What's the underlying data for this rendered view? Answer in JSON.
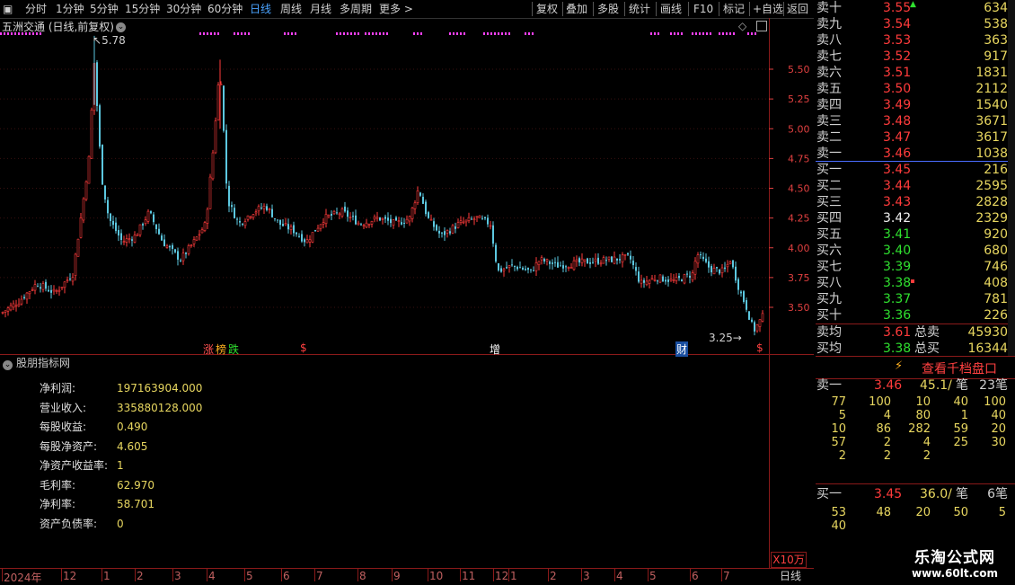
{
  "toolbar": {
    "left_items": [
      "分时",
      "1分钟",
      "5分钟",
      "15分钟",
      "30分钟",
      "60分钟",
      "日线",
      "周线",
      "月线",
      "多周期",
      "更多 >"
    ],
    "active": "日线",
    "right_items": [
      "复权",
      "叠加",
      "多股",
      "统计",
      "画线",
      "F10",
      "标记",
      "+自选",
      "返回"
    ]
  },
  "chart": {
    "title": "五洲交通 (日线,前复权)",
    "y_ticks": [
      "5.50",
      "5.25",
      "5.00",
      "4.75",
      "4.50",
      "4.25",
      "4.00",
      "3.75",
      "3.50"
    ],
    "high_label": "5.78",
    "low_label": "3.25",
    "markers": [
      "涨",
      "榜",
      "跌",
      "$",
      "增",
      "财",
      "$"
    ],
    "scale_label": "X10万",
    "period_label": "日线",
    "x_ticks": [
      "2024年",
      "12",
      "1",
      "2",
      "3",
      "4",
      "5",
      "6",
      "7",
      "8",
      "9",
      "10",
      "11",
      "12",
      "1",
      "2",
      "3",
      "4",
      "5",
      "6",
      "7"
    ]
  },
  "indicator": {
    "header": "股朋指标网",
    "rows": [
      {
        "label": "净利润:",
        "value": "197163904.000"
      },
      {
        "label": "营业收入:",
        "value": "335880128.000"
      },
      {
        "label": "每股收益:",
        "value": "0.490"
      },
      {
        "label": "每股净资产:",
        "value": "4.605"
      },
      {
        "label": "净资产收益率:",
        "value": "1"
      },
      {
        "label": "毛利率:",
        "value": "62.970"
      },
      {
        "label": "净利率:",
        "value": "58.701"
      },
      {
        "label": "资产负债率:",
        "value": "0"
      }
    ]
  },
  "book": {
    "sells": [
      {
        "name": "卖十",
        "price": "3.55",
        "vol": "634"
      },
      {
        "name": "卖九",
        "price": "3.54",
        "vol": "538"
      },
      {
        "name": "卖八",
        "price": "3.53",
        "vol": "363"
      },
      {
        "name": "卖七",
        "price": "3.52",
        "vol": "917"
      },
      {
        "name": "卖六",
        "price": "3.51",
        "vol": "1831"
      },
      {
        "name": "卖五",
        "price": "3.50",
        "vol": "2112"
      },
      {
        "name": "卖四",
        "price": "3.49",
        "vol": "1540"
      },
      {
        "name": "卖三",
        "price": "3.48",
        "vol": "3671"
      },
      {
        "name": "卖二",
        "price": "3.47",
        "vol": "3617"
      },
      {
        "name": "卖一",
        "price": "3.46",
        "vol": "1038"
      }
    ],
    "buys": [
      {
        "name": "买一",
        "price": "3.45",
        "vol": "216"
      },
      {
        "name": "买二",
        "price": "3.44",
        "vol": "2595"
      },
      {
        "name": "买三",
        "price": "3.43",
        "vol": "2828"
      },
      {
        "name": "买四",
        "price": "3.42",
        "vol": "2329"
      },
      {
        "name": "买五",
        "price": "3.41",
        "vol": "920"
      },
      {
        "name": "买六",
        "price": "3.40",
        "vol": "680"
      },
      {
        "name": "买七",
        "price": "3.39",
        "vol": "746"
      },
      {
        "name": "买八",
        "price": "3.38",
        "vol": "408"
      },
      {
        "name": "买九",
        "price": "3.37",
        "vol": "781"
      },
      {
        "name": "买十",
        "price": "3.36",
        "vol": "226"
      }
    ],
    "avg_sell": {
      "label": "卖均",
      "price": "3.61",
      "total_label": "总卖",
      "total": "45930"
    },
    "avg_buy": {
      "label": "买均",
      "price": "3.38",
      "total_label": "总买",
      "total": "16344"
    }
  },
  "depth": {
    "button": "查看千档盘口",
    "sell1": {
      "label": "卖一",
      "price": "3.46",
      "per": "45.1/",
      "unit": "笔",
      "count": "23笔"
    },
    "sell_grid": [
      [
        "77",
        "100",
        "10",
        "40",
        "100"
      ],
      [
        "5",
        "4",
        "80",
        "1",
        "40"
      ],
      [
        "10",
        "86",
        "282",
        "59",
        "20"
      ],
      [
        "57",
        "2",
        "4",
        "25",
        "30"
      ],
      [
        "2",
        "2",
        "2",
        "",
        ""
      ]
    ],
    "buy1": {
      "label": "买一",
      "price": "3.45",
      "per": "36.0/",
      "unit": "笔",
      "count": "6笔"
    },
    "buy_grid": [
      [
        "53",
        "48",
        "20",
        "50",
        "5"
      ],
      [
        "40",
        "",
        "",
        "",
        ""
      ]
    ]
  },
  "watermark": {
    "line1": "乐淘公式网",
    "line2": "www.60lt.com"
  },
  "colors": {
    "up": "#ff3b3b",
    "down": "#2fe02f",
    "candle_down": "#5cc8e0",
    "volume": "#e8d760",
    "magenta": "#ff40ff"
  }
}
